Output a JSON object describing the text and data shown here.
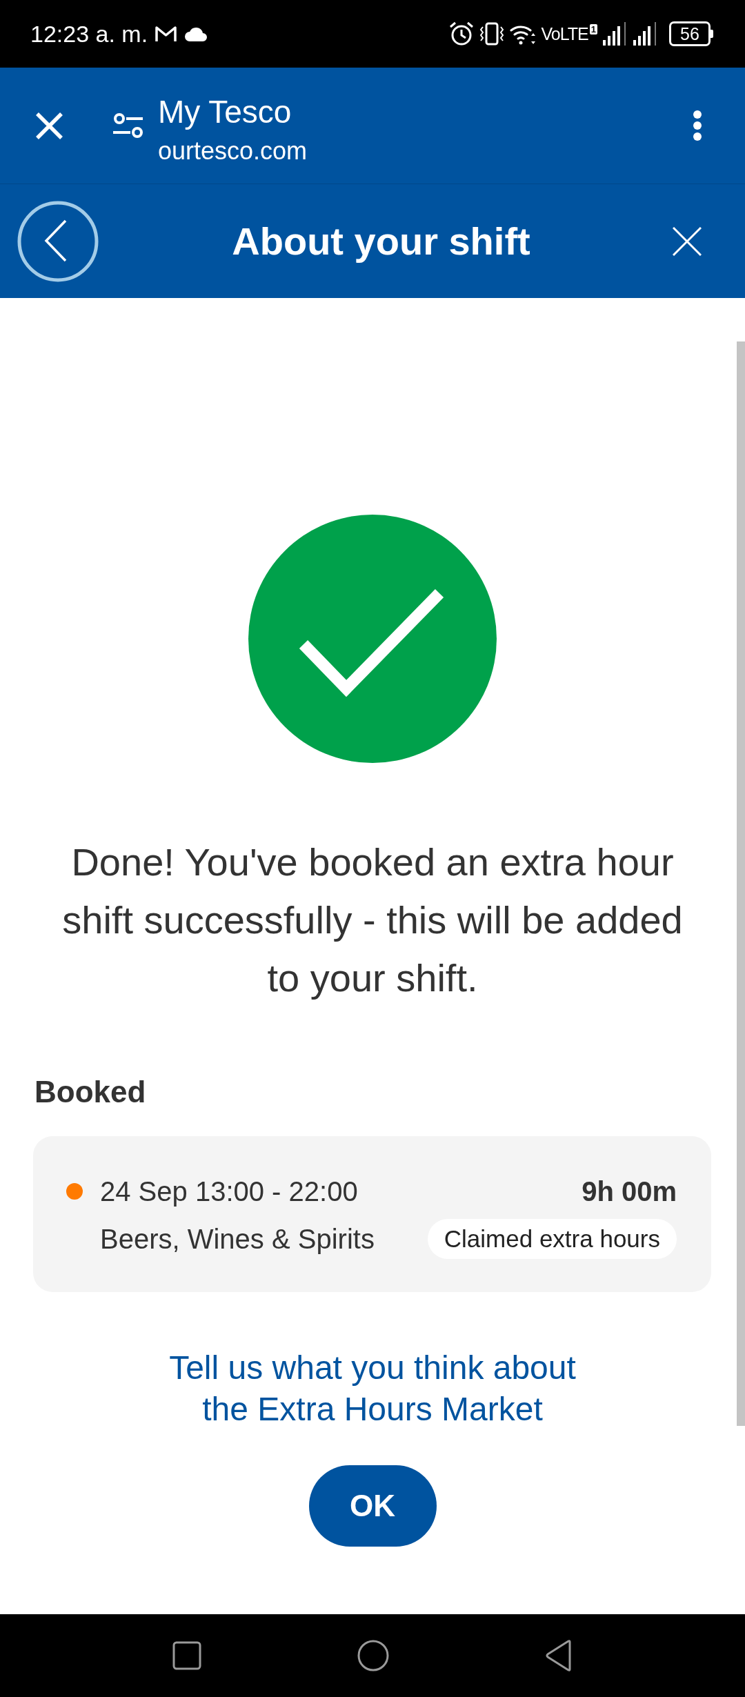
{
  "status_bar": {
    "time": "12:23 a. m.",
    "network": "VoLTE",
    "sim": "1",
    "battery": "56"
  },
  "browser_bar": {
    "title": "My Tesco",
    "url": "ourtesco.com"
  },
  "header": {
    "title": "About your shift"
  },
  "confirmation": {
    "message": "Done! You've booked an extra hour shift successfully - this will be added to your shift.",
    "section_title": "Booked"
  },
  "shifts": [
    {
      "date_time": "24 Sep 13:00 - 22:00",
      "duration": "9h 00m",
      "department": "Beers, Wines & Spirits",
      "tag": "Claimed extra hours",
      "color": "#ff7a00"
    }
  ],
  "feedback_link": "Tell us what you think about the Extra Hours Market",
  "buttons": [
    "OK"
  ]
}
